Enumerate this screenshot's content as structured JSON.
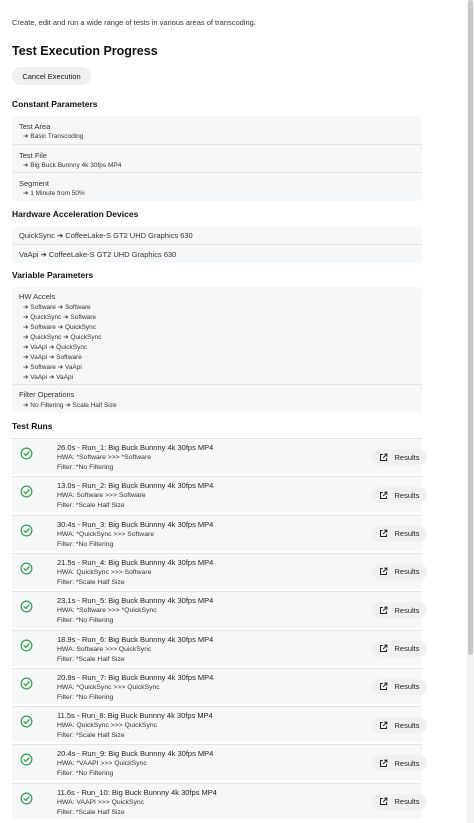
{
  "intro": "Create, edit and run a wide range of tests in various areas of transcoding.",
  "title": "Test Execution Progress",
  "cancel_label": "Cancel Execution",
  "constant": {
    "heading": "Constant Parameters",
    "items": [
      {
        "label": "Test Area",
        "value": "➔ Basic Transcoding"
      },
      {
        "label": "Test File",
        "value": "➔ Big Buck Bunnny 4k 30fps MP4"
      },
      {
        "label": "Segment",
        "value": "➔ 1 Minute from 50%"
      }
    ]
  },
  "hardware": {
    "heading": "Hardware Acceleration Devices",
    "items": [
      "QuickSync ➔ CoffeeLake-S GT2 UHD Graphics 630",
      "VaApi ➔ CoffeeLake-S GT2 UHD Graphics 630"
    ]
  },
  "variable": {
    "heading": "Variable Parameters",
    "hw_label": "HW Accels",
    "hw_items": [
      "➔ Software ➔ Software",
      "➔ QuickSync ➔ Software",
      "➔ Software ➔ QuickSync",
      "➔ QuickSync ➔ QuickSync",
      "➔ VaApi ➔ QuickSync",
      "➔ VaApi ➔ Software",
      "➔ Software ➔ VaApi",
      "➔ VaApi ➔ VaApi"
    ],
    "filter_label": "Filter Operations",
    "filter_value": "➔ No Filtering  ➔ Scale Half Size"
  },
  "runs_heading": "Test Runs",
  "results_label": "Results",
  "success_color": "#2da44e",
  "runs": [
    {
      "title": "26.0s - Run_1: Big Buck Bunnny 4k 30fps MP4",
      "hwa": "HWA: *Software >>> *Software",
      "filter": "Filter: *No Filtering"
    },
    {
      "title": "13.0s - Run_2: Big Buck Bunnny 4k 30fps MP4",
      "hwa": "HWA: Software >>> Software",
      "filter": "Filter: *Scale Half Size"
    },
    {
      "title": "30.4s - Run_3: Big Buck Bunnny 4k 30fps MP4",
      "hwa": "HWA: *QuickSync >>> Software",
      "filter": "Filter: *No Filtering"
    },
    {
      "title": "21.5s - Run_4: Big Buck Bunnny 4k 30fps MP4",
      "hwa": "HWA: QuickSync >>> Software",
      "filter": "Filter: *Scale Half Size"
    },
    {
      "title": "23.1s - Run_5: Big Buck Bunnny 4k 30fps MP4",
      "hwa": "HWA: *Software >>> *QuickSync",
      "filter": "Filter: *No Filtering"
    },
    {
      "title": "18.9s - Run_6: Big Buck Bunnny 4k 30fps MP4",
      "hwa": "HWA: Software >>> QuickSync",
      "filter": "Filter: *Scale Half Size"
    },
    {
      "title": "20.9s - Run_7: Big Buck Bunnny 4k 30fps MP4",
      "hwa": "HWA: *QuickSync >>> QuickSync",
      "filter": "Filter: *No Filtering"
    },
    {
      "title": "11.5s - Run_8: Big Buck Bunnny 4k 30fps MP4",
      "hwa": "HWA: QuickSync >>> QuickSync",
      "filter": "Filter: *Scale Half Size"
    },
    {
      "title": "20.4s - Run_9: Big Buck Bunnny 4k 30fps MP4",
      "hwa": "HWA: *VAAPI >>> QuickSync",
      "filter": "Filter: *No Filtering"
    },
    {
      "title": "11.6s - Run_10: Big Buck Bunnny 4k 30fps MP4",
      "hwa": "HWA: VAAPI >>> QuickSync",
      "filter": "Filter: *Scale Half Size"
    }
  ]
}
